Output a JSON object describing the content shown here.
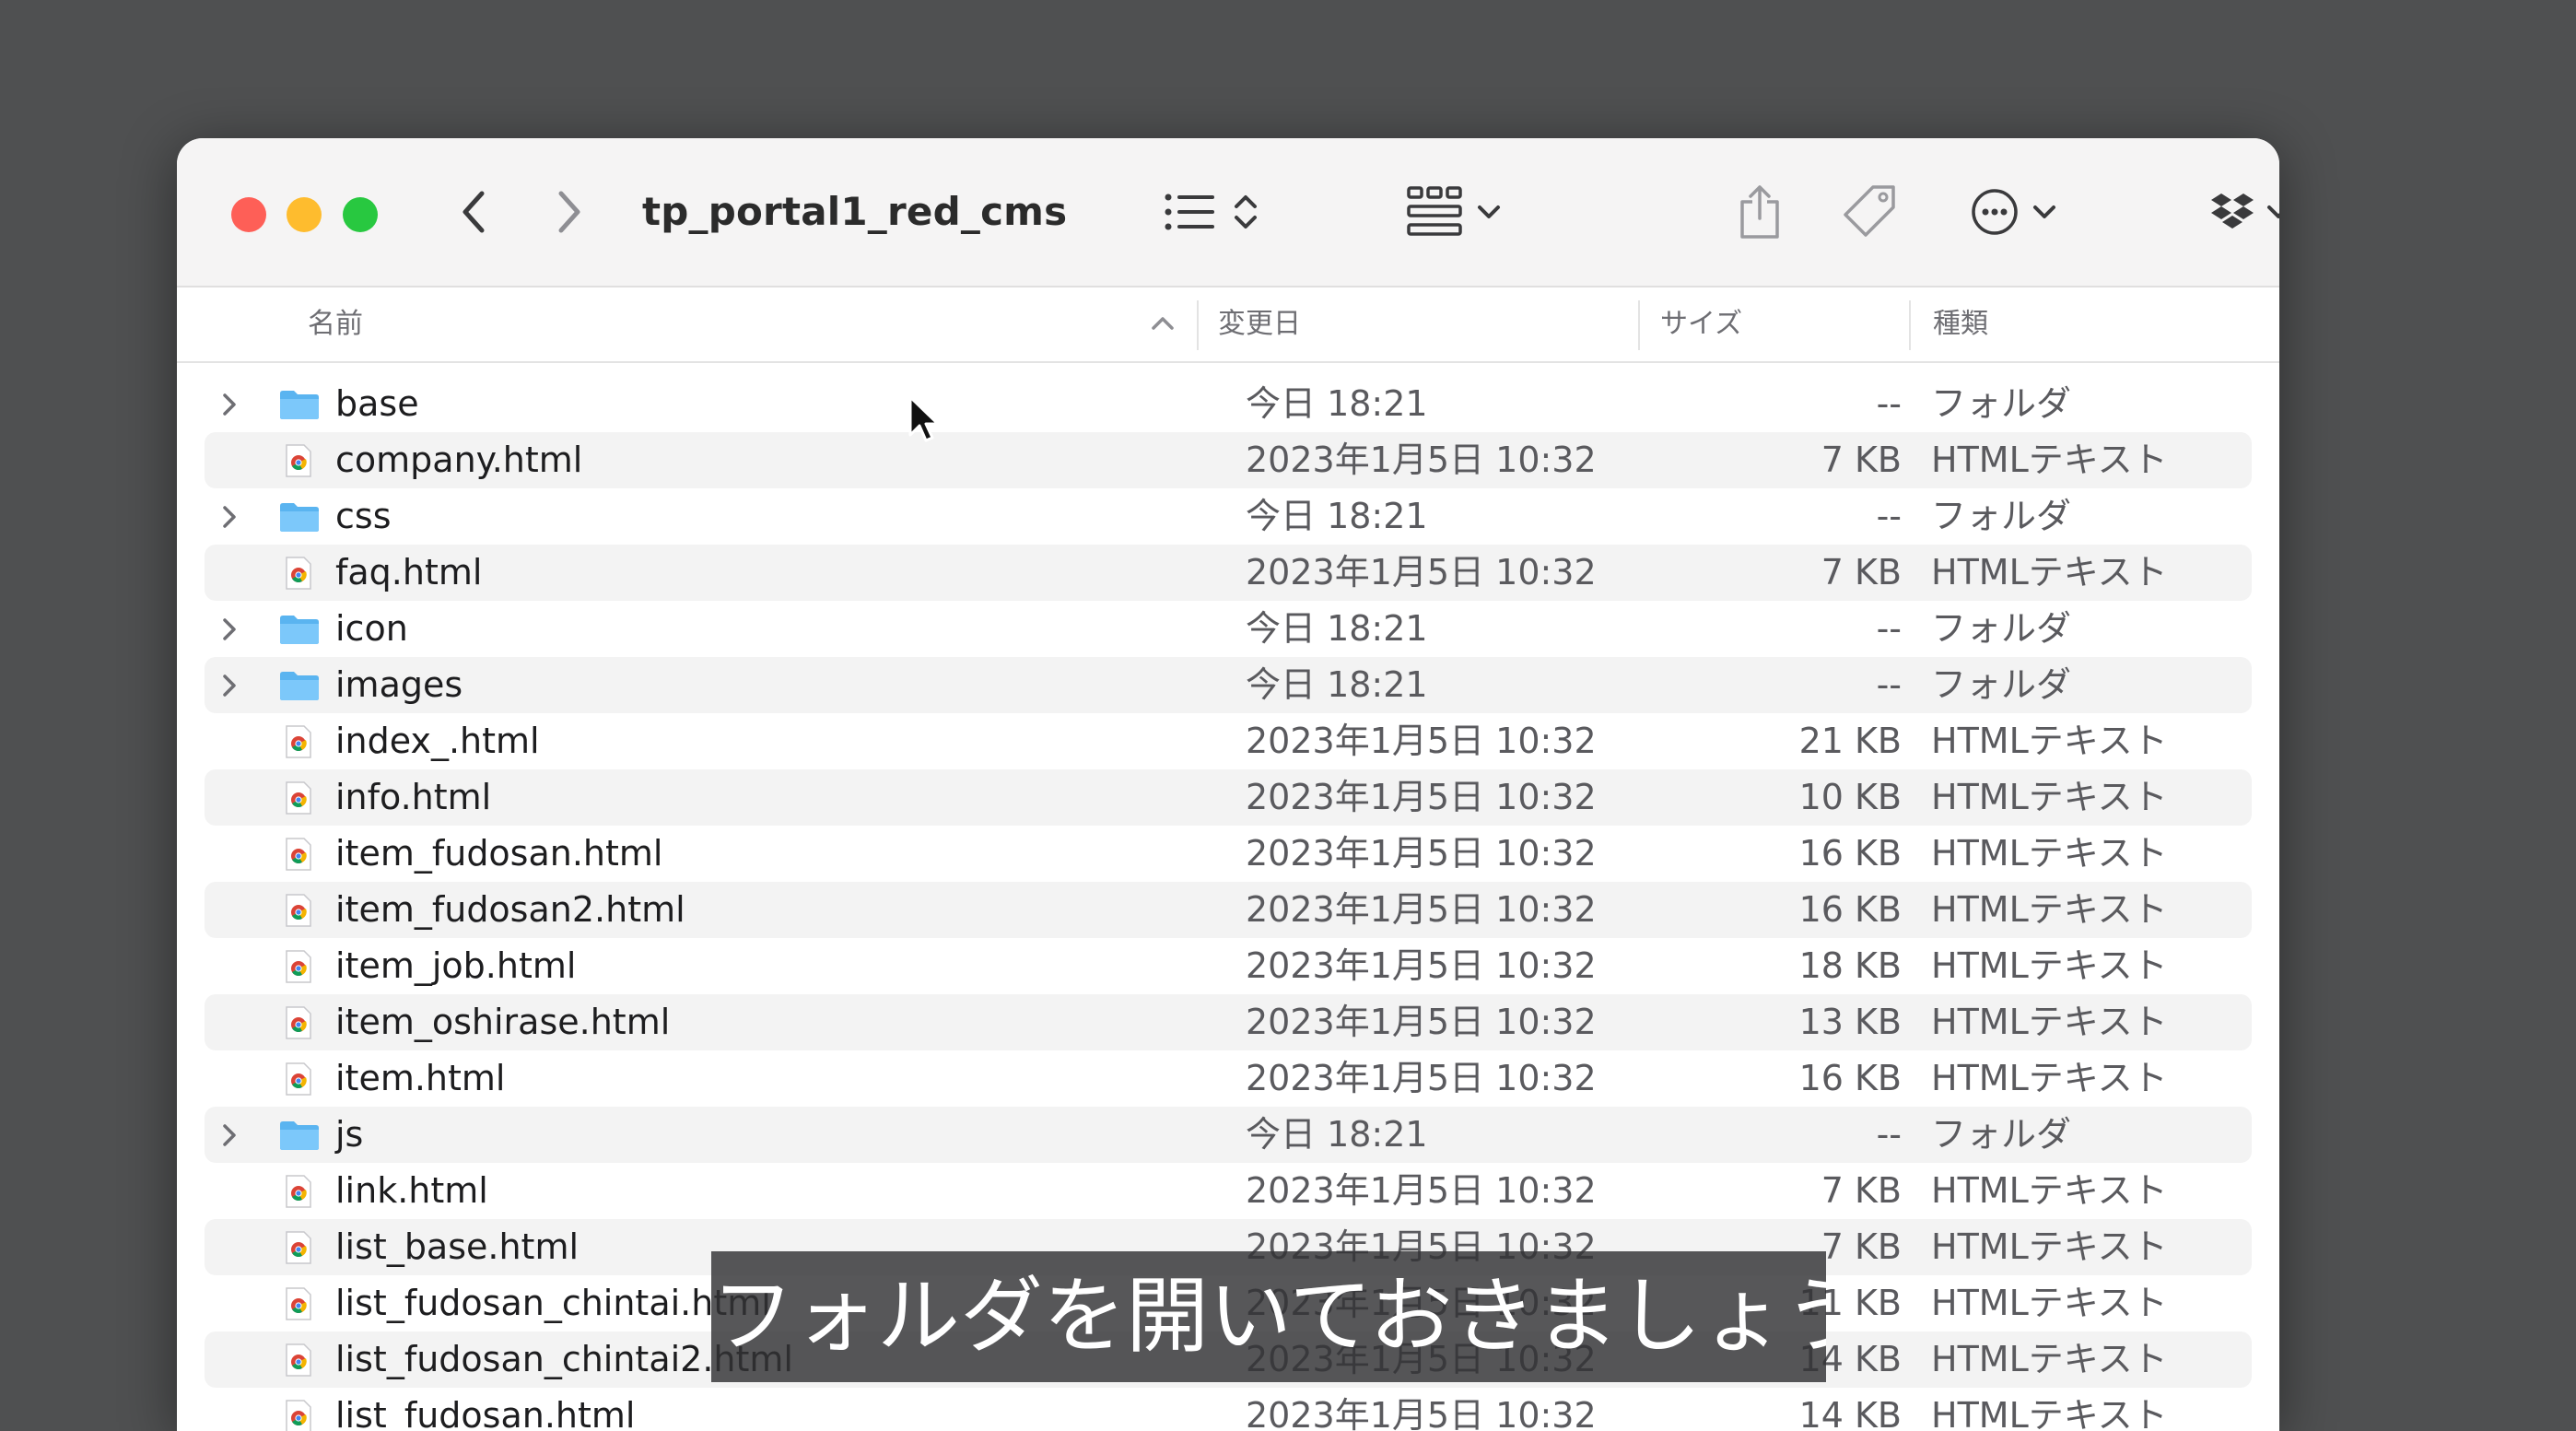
{
  "window": {
    "title": "tp_portal1_red_cms"
  },
  "columns": {
    "name": "名前",
    "date": "変更日",
    "size": "サイズ",
    "kind": "種類"
  },
  "files": [
    {
      "name": "base",
      "date": "今日 18:21",
      "size": "--",
      "kind": "フォルダ",
      "type": "folder"
    },
    {
      "name": "company.html",
      "date": "2023年1月5日 10:32",
      "size": "7 KB",
      "kind": "HTMLテキスト",
      "type": "html"
    },
    {
      "name": "css",
      "date": "今日 18:21",
      "size": "--",
      "kind": "フォルダ",
      "type": "folder"
    },
    {
      "name": "faq.html",
      "date": "2023年1月5日 10:32",
      "size": "7 KB",
      "kind": "HTMLテキスト",
      "type": "html"
    },
    {
      "name": "icon",
      "date": "今日 18:21",
      "size": "--",
      "kind": "フォルダ",
      "type": "folder"
    },
    {
      "name": "images",
      "date": "今日 18:21",
      "size": "--",
      "kind": "フォルダ",
      "type": "folder"
    },
    {
      "name": "index_.html",
      "date": "2023年1月5日 10:32",
      "size": "21 KB",
      "kind": "HTMLテキスト",
      "type": "html"
    },
    {
      "name": "info.html",
      "date": "2023年1月5日 10:32",
      "size": "10 KB",
      "kind": "HTMLテキスト",
      "type": "html"
    },
    {
      "name": "item_fudosan.html",
      "date": "2023年1月5日 10:32",
      "size": "16 KB",
      "kind": "HTMLテキスト",
      "type": "html"
    },
    {
      "name": "item_fudosan2.html",
      "date": "2023年1月5日 10:32",
      "size": "16 KB",
      "kind": "HTMLテキスト",
      "type": "html"
    },
    {
      "name": "item_job.html",
      "date": "2023年1月5日 10:32",
      "size": "18 KB",
      "kind": "HTMLテキスト",
      "type": "html"
    },
    {
      "name": "item_oshirase.html",
      "date": "2023年1月5日 10:32",
      "size": "13 KB",
      "kind": "HTMLテキスト",
      "type": "html"
    },
    {
      "name": "item.html",
      "date": "2023年1月5日 10:32",
      "size": "16 KB",
      "kind": "HTMLテキスト",
      "type": "html"
    },
    {
      "name": "js",
      "date": "今日 18:21",
      "size": "--",
      "kind": "フォルダ",
      "type": "folder"
    },
    {
      "name": "link.html",
      "date": "2023年1月5日 10:32",
      "size": "7 KB",
      "kind": "HTMLテキスト",
      "type": "html"
    },
    {
      "name": "list_base.html",
      "date": "2023年1月5日 10:32",
      "size": "7 KB",
      "kind": "HTMLテキスト",
      "type": "html"
    },
    {
      "name": "list_fudosan_chintai.html",
      "date": "2023年1月5日 10:32",
      "size": "11 KB",
      "kind": "HTMLテキスト",
      "type": "html"
    },
    {
      "name": "list_fudosan_chintai2.html",
      "date": "2023年1月5日 10:32",
      "size": "14 KB",
      "kind": "HTMLテキスト",
      "type": "html"
    },
    {
      "name": "list_fudosan.html",
      "date": "2023年1月5日 10:32",
      "size": "14 KB",
      "kind": "HTMLテキスト",
      "type": "html"
    }
  ],
  "subtitle": "フォルダを開いておきましょう。",
  "colors": {
    "desktop": "#4f5051",
    "folder": "#5ab4f0",
    "close": "#fe5f57",
    "minimize": "#febc2e",
    "zoom": "#28c840",
    "row_alt": "#f3f3f3"
  },
  "icons": [
    "back-icon",
    "forward-icon",
    "list-view-icon",
    "sort-updown-icon",
    "grid-view-icon",
    "share-icon",
    "tag-icon",
    "more-icon",
    "dropbox-icon",
    "search-icon",
    "folder-icon",
    "chrome-html-icon",
    "disclosure-chevron-icon",
    "pointer-cursor-icon"
  ]
}
